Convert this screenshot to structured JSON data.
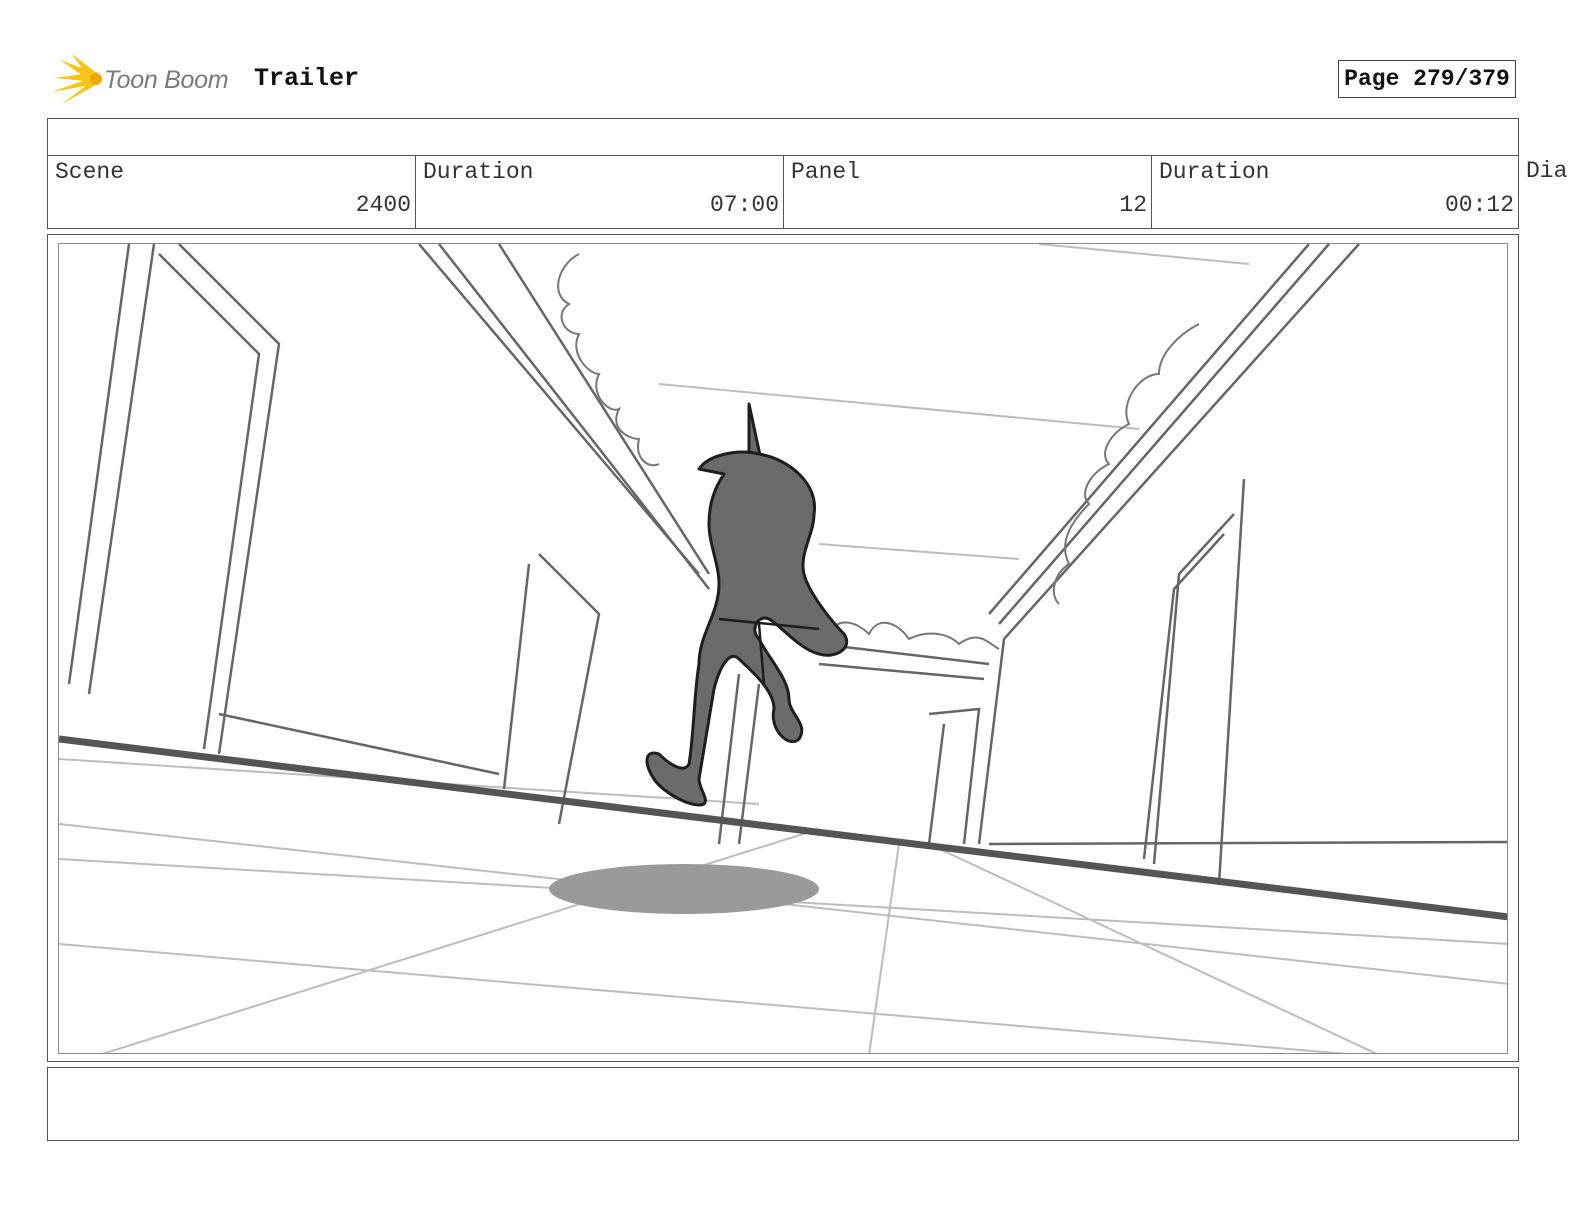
{
  "brand": {
    "name": "Toon Boom",
    "accent_color": "#f5c518"
  },
  "project": {
    "title": "Trailer"
  },
  "page": {
    "label": "Page 279/379"
  },
  "info": {
    "scene_label": "Scene",
    "scene_value": "2400",
    "scene_duration_label": "Duration",
    "scene_duration_value": "07:00",
    "panel_label": "Panel",
    "panel_value": "12",
    "panel_duration_label": "Duration",
    "panel_duration_value": "00:12",
    "dialog_label": "Dia"
  },
  "panel_image": {
    "icon": "storyboard-sketch-running-figure-hallway"
  }
}
